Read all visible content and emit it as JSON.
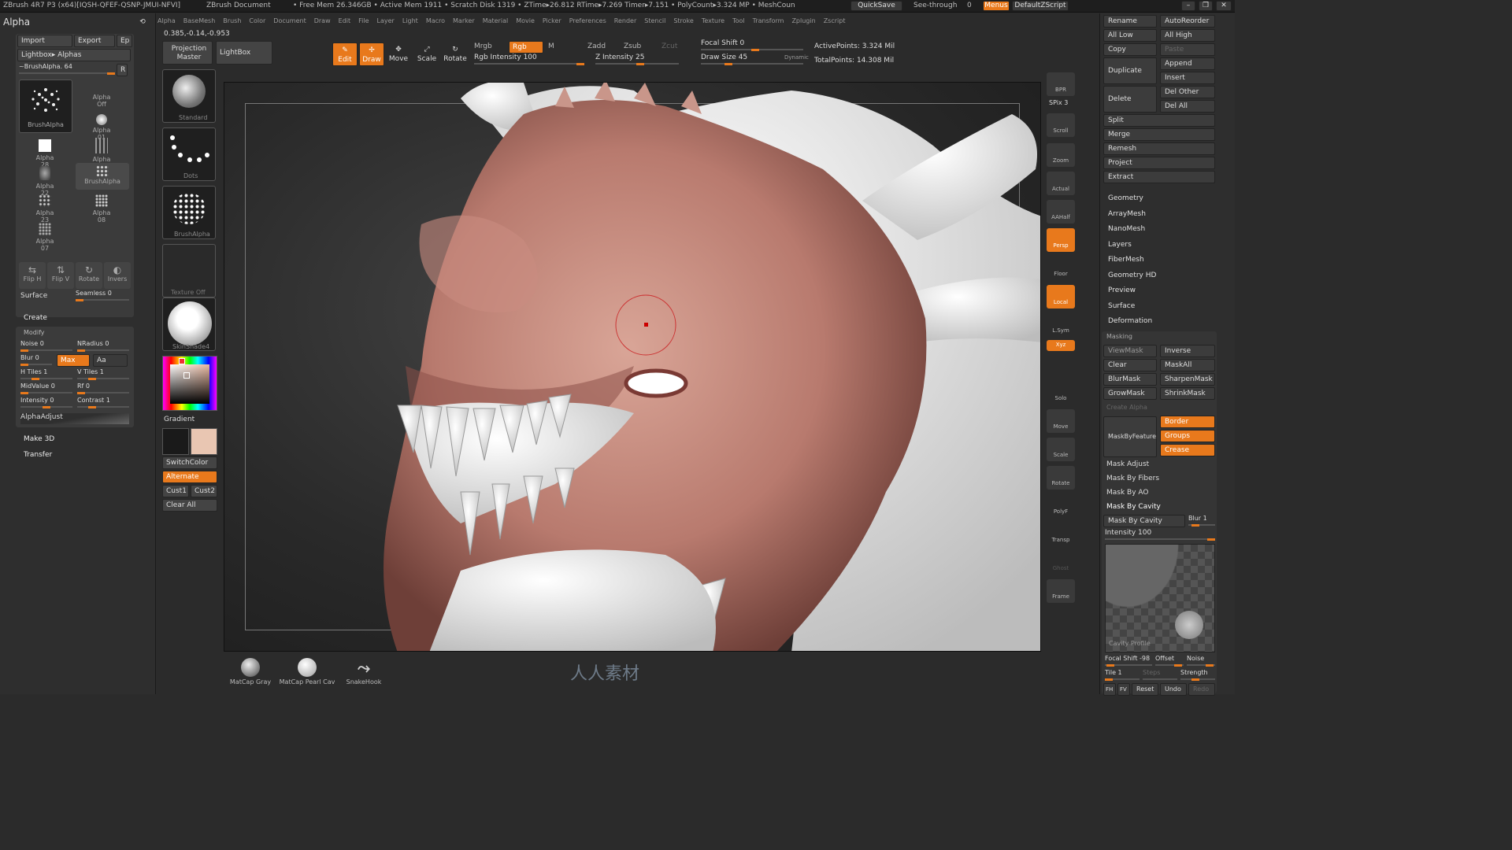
{
  "titlebar": {
    "app": "ZBrush 4R7 P3 (x64)[IQSH-QFEF-QSNP-JMUI-NFVI]",
    "document": "ZBrush Document",
    "stats": "• Free Mem 26.346GB • Active Mem 1911 • Scratch Disk 1319 • ZTime▸26.812 RTime▸7.269 Timer▸7.151 • PolyCount▸3.324 MP • MeshCoun",
    "quicksave": "QuickSave",
    "seethrough": "See-through",
    "seethrough_val": "0",
    "menus": "Menus",
    "script": "DefaultZScript"
  },
  "menubar": [
    "Alpha",
    "BaseMesh",
    "Brush",
    "Color",
    "Document",
    "Draw",
    "Edit",
    "File",
    "Layer",
    "Light",
    "Macro",
    "Marker",
    "Material",
    "Movie",
    "Picker",
    "Preferences",
    "Render",
    "Stencil",
    "Stroke",
    "Texture",
    "Tool",
    "Transform",
    "Zplugin",
    "Zscript"
  ],
  "coords": "0.385,-0.14,-0.953",
  "alpha": {
    "title": "Alpha",
    "import": "Import",
    "export": "Export",
    "ep": "Ep",
    "lightbox": "Lightbox▸ Alphas",
    "current": "~BrushAlpha. 64",
    "r": "R",
    "big_label": "BrushAlpha",
    "items": [
      "Alpha Off",
      "Alpha 01",
      "Alpha 28",
      "Alpha 58",
      "Alpha 22",
      "BrushAlpha",
      "Alpha 23",
      "Alpha 08",
      "Alpha 07"
    ],
    "tools": [
      "Flip H",
      "Flip V",
      "Rotate",
      "Invers"
    ],
    "surface": "Surface",
    "seamless": "Seamless 0",
    "create": "Create",
    "modify": "Modify",
    "noise": "Noise 0",
    "nradius": "NRadius 0",
    "blur": "Blur 0",
    "max": "Max",
    "aa": "Aa",
    "htiles": "H Tiles 1",
    "vtiles": "V Tiles 1",
    "midvalue": "MidValue 0",
    "rf": "Rf 0",
    "intensity": "Intensity 0",
    "contrast": "Contrast 1",
    "alphaadjust": "AlphaAdjust",
    "make3d": "Make 3D",
    "transfer": "Transfer"
  },
  "shelf": {
    "projection": "Projection Master",
    "lightbox": "LightBox",
    "edit": "Edit",
    "draw": "Draw",
    "move": "Move",
    "scale": "Scale",
    "rotate": "Rotate",
    "mrgb": "Mrgb",
    "rgb": "Rgb",
    "m": "M",
    "rgb_intensity": "Rgb Intensity 100",
    "zadd": "Zadd",
    "zsub": "Zsub",
    "zcut": "Zcut",
    "z_intensity": "Z Intensity 25",
    "focal_shift": "Focal Shift 0",
    "draw_size": "Draw Size 45",
    "dynamic": "Dynamic",
    "active_points": "ActivePoints: 3.324  Mil",
    "total_points": "TotalPoints: 14.308  Mil"
  },
  "toolcol": {
    "brush": "Standard",
    "stroke": "Dots",
    "alpha": "BrushAlpha",
    "texture": "Texture Off",
    "material": "SkinShade4",
    "gradient": "Gradient",
    "switchcolor": "SwitchColor",
    "alternate": "Alternate",
    "cust1": "Cust1",
    "cust2": "Cust2",
    "clearall": "Clear All",
    "primary_color": "#1a1a1a",
    "secondary_color": "#e9c6b2"
  },
  "rightstrip": [
    "BPR",
    "SPix 3",
    "Scroll",
    "Zoom",
    "Actual",
    "AAHalf",
    "Persp",
    "Floor",
    "Local",
    "L.Sym",
    "Xyz",
    "Solo",
    "Move",
    "Scale",
    "Rotate",
    "PolyF",
    "Transp",
    "Ghost",
    "Frame"
  ],
  "rightpanel": {
    "rename": "Rename",
    "autoreorder": "AutoReorder",
    "alllow": "All Low",
    "allhigh": "All High",
    "copy": "Copy",
    "paste": "Paste",
    "append": "Append",
    "duplicate": "Duplicate",
    "insert": "Insert",
    "delete": "Delete",
    "delother": "Del Other",
    "delall": "Del All",
    "split": "Split",
    "merge": "Merge",
    "remesh": "Remesh",
    "project": "Project",
    "extract": "Extract",
    "sections": [
      "Geometry",
      "ArrayMesh",
      "NanoMesh",
      "Layers",
      "FiberMesh",
      "Geometry HD",
      "Preview",
      "Surface",
      "Deformation"
    ],
    "masking": "Masking",
    "viewmask": "ViewMask",
    "inverse": "Inverse",
    "clear": "Clear",
    "maskall": "MaskAll",
    "blurmask": "BlurMask",
    "sharpenmask": "SharpenMask",
    "growmask": "GrowMask",
    "shrinkmask": "ShrinkMask",
    "createalpha": "Create Alpha",
    "maskbyfeature": "MaskByFeature",
    "border": "Border",
    "groups": "Groups",
    "crease": "Crease",
    "maskadjust": "Mask Adjust",
    "maskbyfibers": "Mask By Fibers",
    "maskbyao": "Mask By AO",
    "maskbycavity_head": "Mask By Cavity",
    "maskbycavity": "Mask By Cavity",
    "blur1": "Blur 1",
    "intensity": "Intensity 100",
    "cavityprofile": "Cavity Profile",
    "focalshift": "Focal Shift -98",
    "offset": "Offset",
    "noise": "Noise",
    "tile": "Tile 1",
    "steps": "Steps",
    "strength": "Strength",
    "fh": "FH",
    "fv": "FV",
    "reset": "Reset",
    "undo": "Undo",
    "redo": "Redo"
  },
  "bottom": {
    "materials": [
      "MatCap Gray",
      "MatCap Pearl Cav",
      "SnakeHook"
    ],
    "watermark": "人人素材"
  }
}
